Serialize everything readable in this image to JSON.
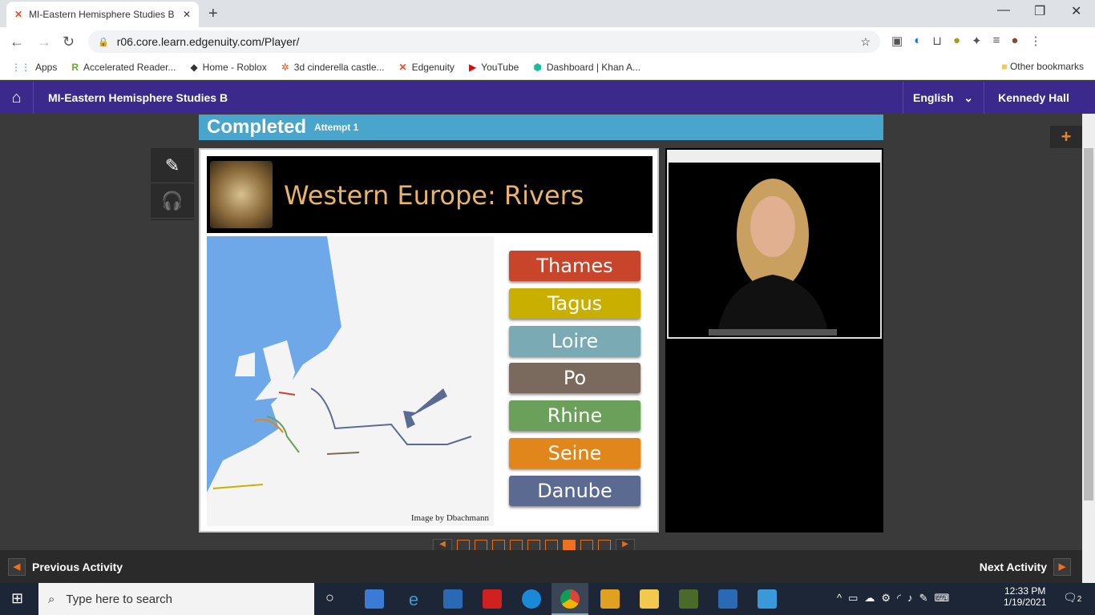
{
  "browser": {
    "tab_title": "MI-Eastern Hemisphere Studies B",
    "url": "r06.core.learn.edgenuity.com/Player/",
    "bookmarks": [
      "Apps",
      "Accelerated Reader...",
      "Home - Roblox",
      "3d cinderella castle...",
      "Edgenuity",
      "YouTube",
      "Dashboard | Khan A..."
    ],
    "other_bookmarks": "Other bookmarks"
  },
  "header": {
    "course": "MI-Eastern Hemisphere Studies B",
    "language": "English",
    "user": "Kennedy Hall"
  },
  "status": {
    "completed": "Completed",
    "attempt": "Attempt 1"
  },
  "slide": {
    "title": "Western Europe: Rivers",
    "credit": "Image by Dbachmann",
    "rivers": [
      {
        "name": "Thames",
        "color": "#c8442a"
      },
      {
        "name": "Tagus",
        "color": "#c9b000"
      },
      {
        "name": "Loire",
        "color": "#7aaab4"
      },
      {
        "name": "Po",
        "color": "#7a6a5e"
      },
      {
        "name": "Rhine",
        "color": "#6aa05a"
      },
      {
        "name": "Seine",
        "color": "#e0861a"
      },
      {
        "name": "Danube",
        "color": "#5a6a90"
      }
    ]
  },
  "pager": {
    "total": 9,
    "current": 7
  },
  "footer": {
    "prev": "Previous Activity",
    "next": "Next Activity"
  },
  "taskbar": {
    "search_placeholder": "Type here to search",
    "time": "12:33 PM",
    "date": "1/19/2021",
    "notifications": "2"
  }
}
